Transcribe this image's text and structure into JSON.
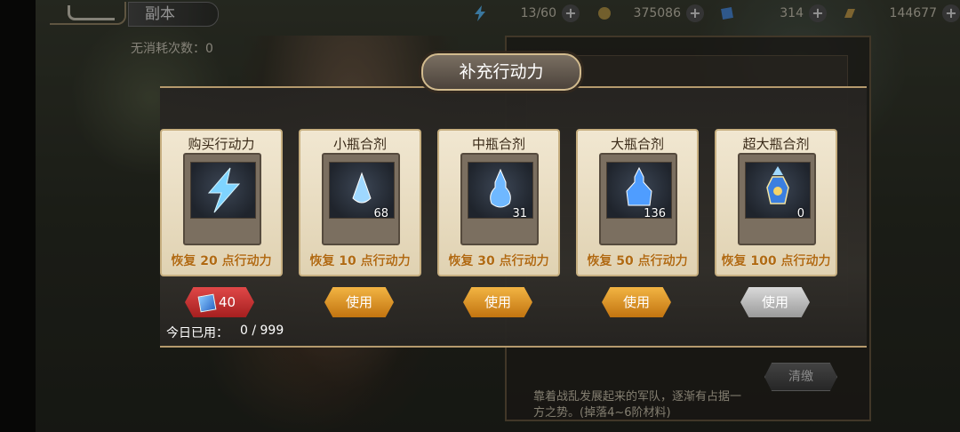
{
  "top_bar": {
    "back_label": "",
    "title": "副本",
    "resources": [
      {
        "icon": "lightning-icon",
        "value": "13/60"
      },
      {
        "icon": "coin-icon",
        "value": "375086"
      },
      {
        "icon": "gem-icon",
        "value": "314"
      },
      {
        "icon": "gold-bar-icon",
        "value": "144677"
      }
    ]
  },
  "background": {
    "consume_label": "无消耗次数：",
    "consume_value": "0",
    "panel_text": "靠着战乱发展起来的军队，逐渐有占据一方之势。(掉落4~6阶材料)",
    "panel_button": "清缴"
  },
  "modal": {
    "title": "补充行动力",
    "cards": [
      {
        "name": "购买行动力",
        "icon": "lightning-icon",
        "count": "",
        "desc": "恢复 20 点行动力"
      },
      {
        "name": "小瓶合剂",
        "icon": "small-potion-icon",
        "count": "68",
        "desc": "恢复 10 点行动力"
      },
      {
        "name": "中瓶合剂",
        "icon": "medium-potion-icon",
        "count": "31",
        "desc": "恢复 30 点行动力"
      },
      {
        "name": "大瓶合剂",
        "icon": "large-potion-icon",
        "count": "136",
        "desc": "恢复 50 点行动力"
      },
      {
        "name": "超大瓶合剂",
        "icon": "xl-potion-icon",
        "count": "0",
        "desc": "恢复 100 点行动力"
      }
    ],
    "buy_price": "40",
    "use_label": "使用",
    "used_today_label": "今日已用：",
    "used_today_value": "0 / 999"
  },
  "colors": {
    "accent_gold": "#c7af80",
    "desc_orange": "#b06a12",
    "buy_red": "#e04848",
    "use_orange": "#f2b443"
  }
}
